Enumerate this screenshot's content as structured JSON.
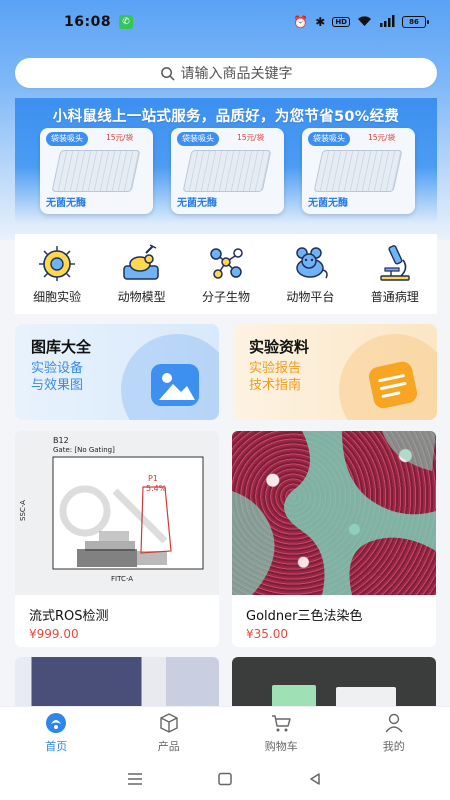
{
  "status_bar": {
    "time": "16:08",
    "network": "HD",
    "battery": "86"
  },
  "search": {
    "placeholder": "请输入商品关键字"
  },
  "banner": {
    "title": "小科鼠线上一站式服务，品质好，为您节省50%经费",
    "products": [
      {
        "tag": "袋装吸头",
        "price": "15元/袋",
        "label": "无菌无酶"
      },
      {
        "tag": "袋装吸头",
        "price": "15元/袋",
        "label": "无菌无酶"
      },
      {
        "tag": "袋装吸头",
        "price": "15元/袋",
        "label": "无菌无酶"
      }
    ]
  },
  "categories": [
    {
      "label": "细胞实验",
      "icon": "cell-icon"
    },
    {
      "label": "动物模型",
      "icon": "animal-model-icon"
    },
    {
      "label": "分子生物",
      "icon": "molecule-icon"
    },
    {
      "label": "动物平台",
      "icon": "mouse-icon"
    },
    {
      "label": "普通病理",
      "icon": "microscope-icon"
    }
  ],
  "features": [
    {
      "title": "图库大全",
      "line1": "实验设备",
      "line2": "与效果图",
      "color": "#3a8be8"
    },
    {
      "title": "实验资料",
      "line1": "实验报告",
      "line2": "技术指南",
      "color": "#f29c1f"
    }
  ],
  "products": [
    {
      "name": "流式ROS检测",
      "price": "¥999.00",
      "image": {
        "sample": "B12",
        "gate": "Gate: [No Gating]",
        "gate_label": "P1",
        "gate_percent": "5.4%",
        "x_axis": "FITC-A",
        "y_axis": "SSC-A"
      }
    },
    {
      "name": "Goldner三色法染色",
      "price": "¥35.00"
    },
    {
      "name": "",
      "price": ""
    },
    {
      "name": "",
      "price": ""
    }
  ],
  "bottom_nav": [
    {
      "label": "首页",
      "icon": "home-icon",
      "active": true
    },
    {
      "label": "产品",
      "icon": "product-box-icon",
      "active": false
    },
    {
      "label": "购物车",
      "icon": "cart-icon",
      "active": false
    },
    {
      "label": "我的",
      "icon": "profile-icon",
      "active": false
    }
  ],
  "colors": {
    "accent": "#2f86e8",
    "price": "#e64a3a",
    "banner": "#3d8ff0"
  }
}
